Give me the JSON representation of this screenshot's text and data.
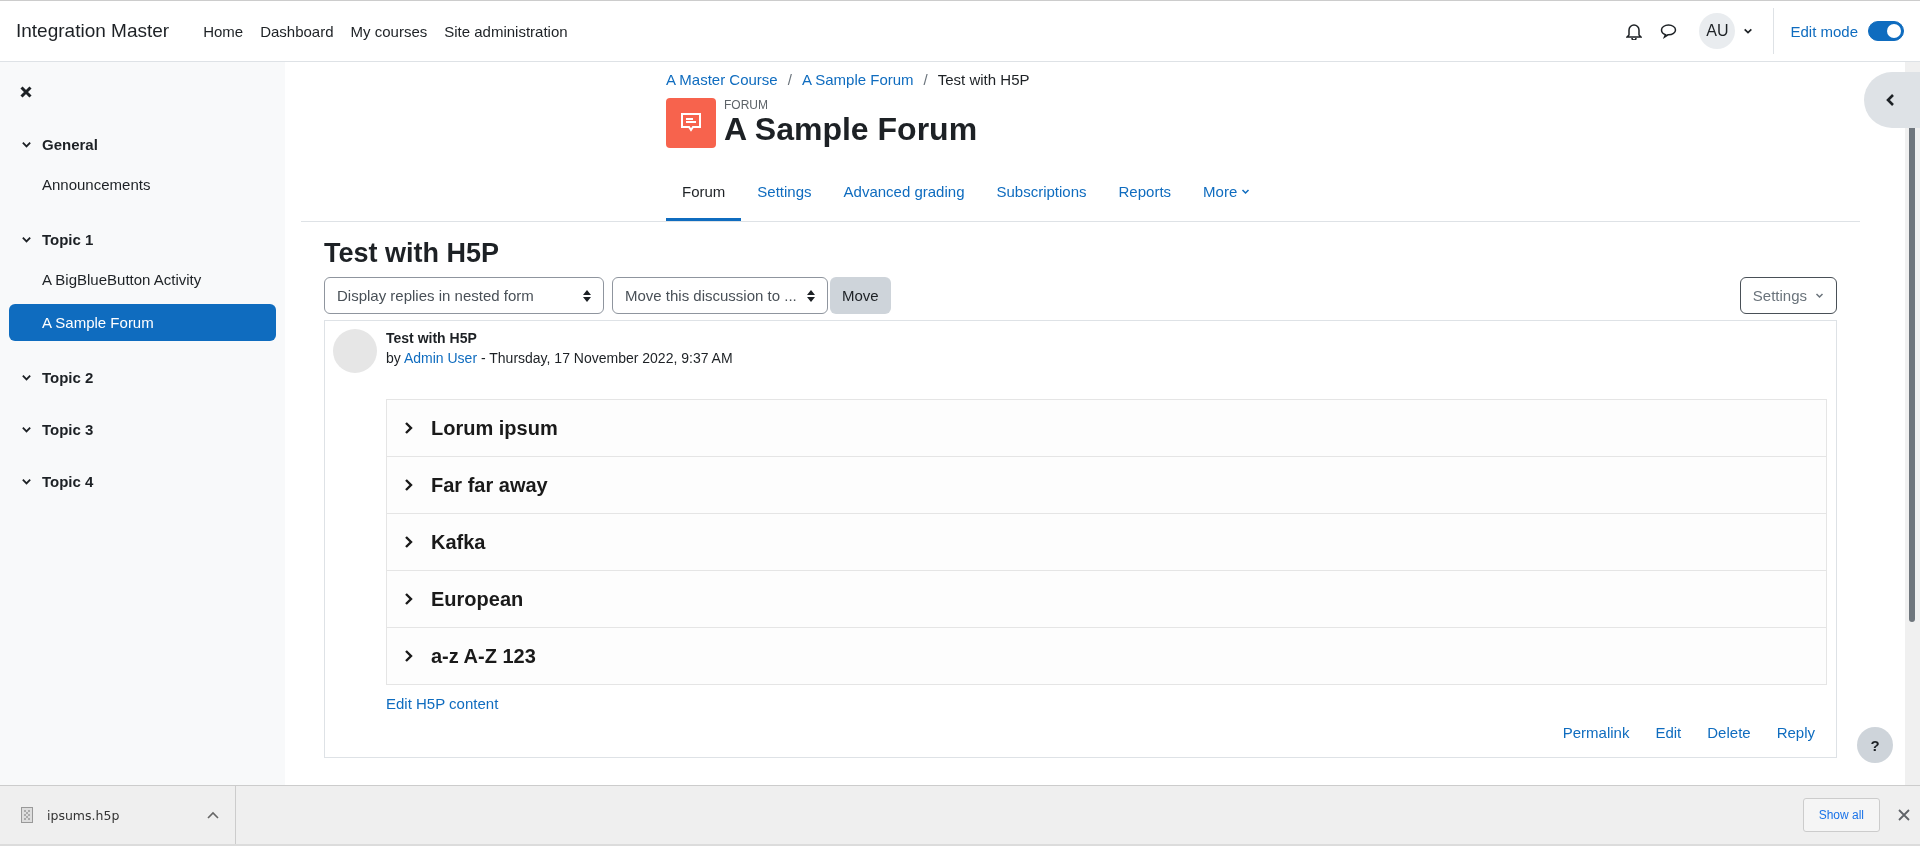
{
  "navbar": {
    "site_name": "Integration Master",
    "links": [
      "Home",
      "Dashboard",
      "My courses",
      "Site administration"
    ],
    "avatar": "AU",
    "edit_mode": {
      "label": "Edit mode",
      "on": true
    }
  },
  "sidebar": {
    "sections": [
      {
        "title": "General",
        "expanded": true,
        "items": [
          {
            "label": "Announcements",
            "selected": false
          }
        ]
      },
      {
        "title": "Topic 1",
        "expanded": true,
        "items": [
          {
            "label": "A BigBlueButton Activity",
            "selected": false
          },
          {
            "label": "A Sample Forum",
            "selected": true
          }
        ]
      },
      {
        "title": "Topic 2",
        "expanded": true
      },
      {
        "title": "Topic 3",
        "expanded": true
      },
      {
        "title": "Topic 4",
        "expanded": true
      }
    ]
  },
  "breadcrumb": {
    "separator": "/",
    "items": [
      "A Master Course",
      "A Sample Forum",
      "Test with H5P"
    ]
  },
  "activity": {
    "type_label": "FORUM",
    "title": "A Sample Forum"
  },
  "tabs": [
    {
      "label": "Forum",
      "selected": true,
      "kind": "link"
    },
    {
      "label": "Settings",
      "selected": false,
      "kind": "link"
    },
    {
      "label": "Advanced grading",
      "selected": false,
      "kind": "link"
    },
    {
      "label": "Subscriptions",
      "selected": false,
      "kind": "link"
    },
    {
      "label": "Reports",
      "selected": false,
      "kind": "link"
    },
    {
      "label": "More",
      "selected": false,
      "kind": "dropdown"
    }
  ],
  "discussion": {
    "title": "Test with H5P",
    "display_select": "Display replies in nested form",
    "move_select": "Move this discussion to ...",
    "move_button": "Move",
    "settings_button": "Settings"
  },
  "post": {
    "subject": "Test with H5P",
    "by": "by",
    "author": "Admin User",
    "date": " - Thursday, 17 November 2022, 9:37 AM",
    "accordion": [
      {
        "title": "Lorum ipsum",
        "expanded": false
      },
      {
        "title": "Far far away",
        "expanded": false
      },
      {
        "title": "Kafka",
        "expanded": false
      },
      {
        "title": "European",
        "expanded": false
      },
      {
        "title": "a-z A-Z 123",
        "expanded": false
      }
    ],
    "edit_link": "Edit H5P content",
    "actions": [
      "Permalink",
      "Edit",
      "Delete",
      "Reply"
    ]
  },
  "help": "?",
  "download_bar": {
    "file": "ipsums.h5p",
    "show_all": "Show all"
  }
}
